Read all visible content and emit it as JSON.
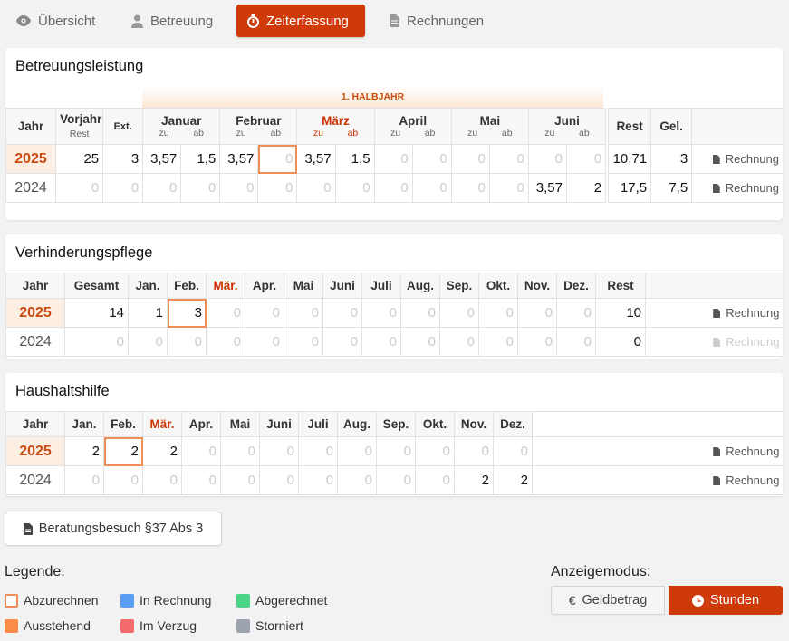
{
  "tabs": [
    {
      "label": "Übersicht",
      "icon": "eye-icon",
      "active": false
    },
    {
      "label": "Betreuung",
      "icon": "person-icon",
      "active": false
    },
    {
      "label": "Zeiterfassung",
      "icon": "stopwatch-icon",
      "active": true
    },
    {
      "label": "Rechnungen",
      "icon": "document-icon",
      "active": false
    }
  ],
  "betreuung": {
    "title": "Betreuungsleistung",
    "halfyear": "1. HALBJAHR",
    "headers": {
      "jahr": "Jahr",
      "vorjahr": "Vorjahr",
      "vorjahr_sub": "Rest",
      "ext": "Ext.",
      "rest": "Rest",
      "gel": "Gel."
    },
    "months": [
      "Januar",
      "Februar",
      "März",
      "April",
      "Mai",
      "Juni"
    ],
    "sub_zu": "zu",
    "sub_ab": "ab",
    "rows": [
      {
        "year": "2025",
        "vorjahr": "25",
        "ext": "3",
        "cells": [
          "3,57",
          "1,5",
          "3,57",
          "0",
          "3,57",
          "1,5",
          "0",
          "0",
          "0",
          "0",
          "0",
          "0"
        ],
        "rest": "10,71",
        "gel": "3",
        "rechnung": "Rechnung"
      },
      {
        "year": "2024",
        "vorjahr": "0",
        "ext": "0",
        "cells": [
          "0",
          "0",
          "0",
          "0",
          "0",
          "0",
          "0",
          "0",
          "0",
          "0",
          "3,57",
          "2"
        ],
        "rest": "17,5",
        "gel": "7,5",
        "rechnung": "Rechnung"
      }
    ]
  },
  "verhinderung": {
    "title": "Verhinderungspflege",
    "headers": [
      "Jahr",
      "Gesamt",
      "Jan.",
      "Feb.",
      "Mär.",
      "Apr.",
      "Mai",
      "Juni",
      "Juli",
      "Aug.",
      "Sep.",
      "Okt.",
      "Nov.",
      "Dez.",
      "Rest"
    ],
    "rows": [
      {
        "year": "2025",
        "cells": [
          "14",
          "1",
          "3",
          "0",
          "0",
          "0",
          "0",
          "0",
          "0",
          "0",
          "0",
          "0",
          "0",
          "10"
        ],
        "rechnung": "Rechnung"
      },
      {
        "year": "2024",
        "cells": [
          "0",
          "0",
          "0",
          "0",
          "0",
          "0",
          "0",
          "0",
          "0",
          "0",
          "0",
          "0",
          "0",
          "0"
        ],
        "rechnung": "Rechnung"
      }
    ]
  },
  "haushalt": {
    "title": "Haushaltshilfe",
    "headers": [
      "Jahr",
      "Jan.",
      "Feb.",
      "Mär.",
      "Apr.",
      "Mai",
      "Juni",
      "Juli",
      "Aug.",
      "Sep.",
      "Okt.",
      "Nov.",
      "Dez."
    ],
    "rows": [
      {
        "year": "2025",
        "cells": [
          "2",
          "2",
          "2",
          "0",
          "0",
          "0",
          "0",
          "0",
          "0",
          "0",
          "0",
          "0"
        ],
        "rechnung": "Rechnung"
      },
      {
        "year": "2024",
        "cells": [
          "0",
          "0",
          "0",
          "0",
          "0",
          "0",
          "0",
          "0",
          "0",
          "0",
          "2",
          "2"
        ],
        "rechnung": "Rechnung"
      }
    ]
  },
  "beratung_button": "Beratungsbesuch §37 Abs 3",
  "legend": {
    "title": "Legende:",
    "items": [
      {
        "label": "Abzurechnen",
        "color": "#f08e57",
        "outline": true
      },
      {
        "label": "In Rechnung",
        "color": "#5b9df5"
      },
      {
        "label": "Abgerechnet",
        "color": "#4cd587"
      },
      {
        "label": "Ausstehend",
        "color": "#fb8c4a"
      },
      {
        "label": "Im Verzug",
        "color": "#f56b6b"
      },
      {
        "label": "Storniert",
        "color": "#9ca3af"
      }
    ]
  },
  "anzeigemodus": {
    "title": "Anzeigemodus:",
    "geld_label": "Geldbetrag",
    "stunden_label": "Stunden",
    "active": "Stunden"
  },
  "colors": {
    "accent": "#cf3a0a",
    "current_year_bg": "#fdeee3",
    "highlight": "#f08e57"
  }
}
